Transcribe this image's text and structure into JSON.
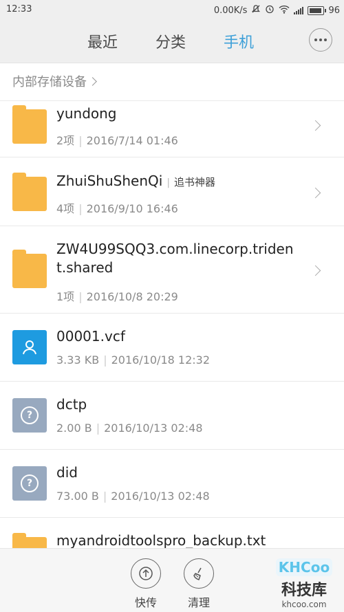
{
  "status_bar": {
    "time": "12:33",
    "net_speed": "0.00K/s",
    "battery": "96"
  },
  "tabs": {
    "recent": "最近",
    "category": "分类",
    "phone": "手机",
    "active": "phone"
  },
  "breadcrumb": "内部存储设备",
  "files": [
    {
      "name": "yundong",
      "tag": "",
      "count_or_size": "2项",
      "date": "2016/7/14 01:46",
      "icon": "folder-icon",
      "has_arrow": true
    },
    {
      "name": "ZhuiShuShenQi",
      "tag": "追书神器",
      "count_or_size": "4项",
      "date": "2016/9/10 16:46",
      "icon": "folder-icon",
      "has_arrow": true
    },
    {
      "name": "ZW4U99SQQ3.com.linecorp.triden",
      "name_line2": "t.shared",
      "tag": "",
      "count_or_size": "1项",
      "date": "2016/10/8 20:29",
      "icon": "folder-icon",
      "has_arrow": true
    },
    {
      "name": "00001.vcf",
      "tag": "",
      "count_or_size": "3.33 KB",
      "date": "2016/10/18 12:32",
      "icon": "contact-file-icon",
      "has_arrow": false
    },
    {
      "name": "dctp",
      "tag": "",
      "count_or_size": "2.00 B",
      "date": "2016/10/13 02:48",
      "icon": "unknown-file-icon",
      "has_arrow": false
    },
    {
      "name": "did",
      "tag": "",
      "count_or_size": "73.00 B",
      "date": "2016/10/13 02:48",
      "icon": "unknown-file-icon",
      "has_arrow": false
    },
    {
      "name": "myandroidtoolspro_backup.txt",
      "tag": "",
      "icon": "folder-icon",
      "has_arrow": false
    }
  ],
  "bottom_bar": {
    "quick_send": "快传",
    "clean": "清理"
  },
  "watermark": {
    "logo": "KHCoo",
    "cn": "科技库",
    "url": "khcoo.com"
  }
}
